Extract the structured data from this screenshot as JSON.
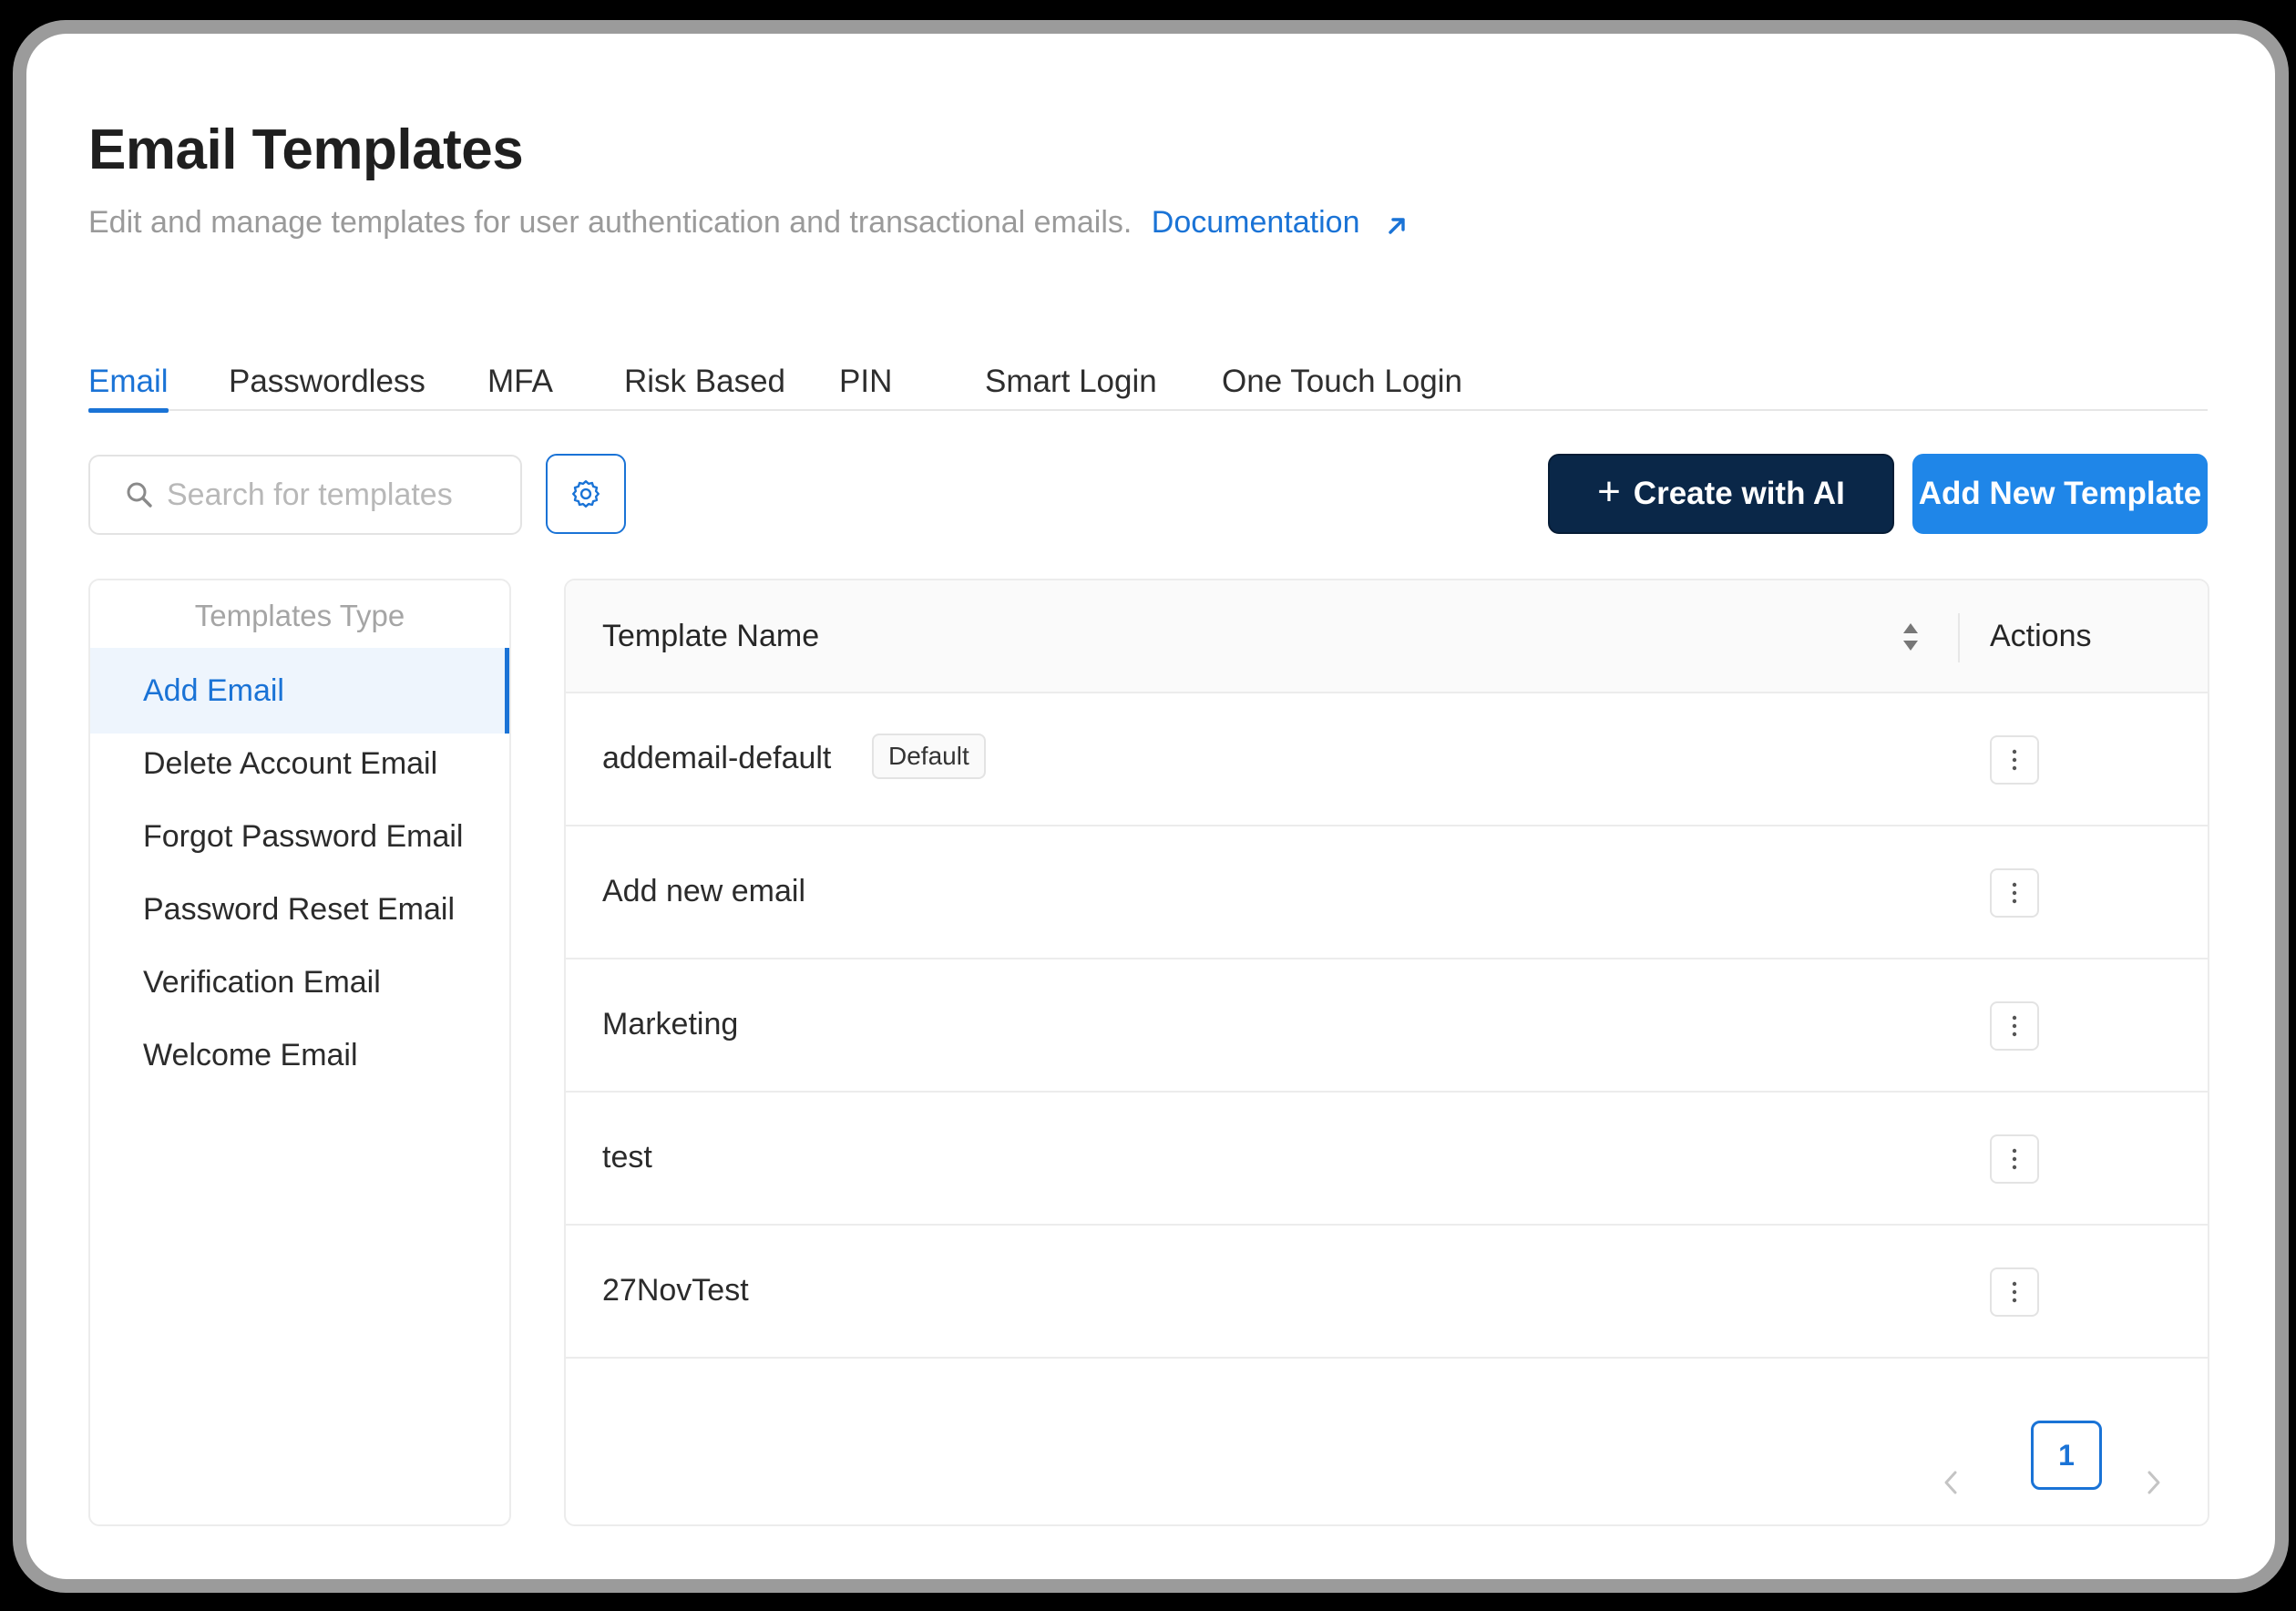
{
  "page": {
    "title": "Email Templates",
    "subtitle": "Edit and manage templates for user authentication and transactional emails.",
    "doc_link": "Documentation"
  },
  "tabs": [
    {
      "label": "Email",
      "active": true
    },
    {
      "label": "Passwordless"
    },
    {
      "label": "MFA"
    },
    {
      "label": "Risk Based"
    },
    {
      "label": "PIN"
    },
    {
      "label": "Smart Login"
    },
    {
      "label": "One Touch Login"
    }
  ],
  "search": {
    "placeholder": "Search for templates",
    "value": ""
  },
  "actions": {
    "create_ai": "Create with AI",
    "add_template": "Add New Template"
  },
  "sidebar": {
    "header": "Templates Type",
    "items": [
      {
        "label": "Add Email",
        "active": true
      },
      {
        "label": "Delete Account Email"
      },
      {
        "label": "Forgot Password Email"
      },
      {
        "label": "Password Reset Email"
      },
      {
        "label": "Verification Email"
      },
      {
        "label": "Welcome Email"
      }
    ]
  },
  "table": {
    "columns": {
      "name": "Template Name",
      "actions": "Actions"
    },
    "rows": [
      {
        "name": "addemail-default",
        "badge": "Default"
      },
      {
        "name": "Add new email"
      },
      {
        "name": "Marketing"
      },
      {
        "name": "test"
      },
      {
        "name": "27NovTest"
      }
    ]
  },
  "pagination": {
    "current": "1"
  },
  "colors": {
    "accent": "#1a73d6",
    "ai_button": "#0a2748",
    "primary_button": "#1f86e8"
  }
}
